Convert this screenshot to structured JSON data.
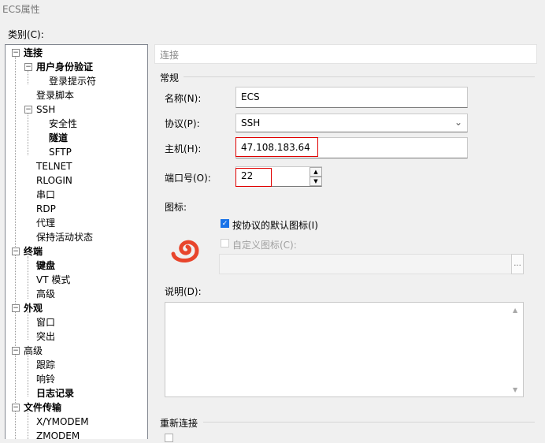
{
  "window": {
    "title": "ECS属性"
  },
  "category": {
    "label": "类别(C):"
  },
  "tree": [
    {
      "label": "连接"
    },
    {
      "label": "用户身份验证"
    },
    {
      "label": "登录提示符"
    },
    {
      "label": "登录脚本"
    },
    {
      "label": "SSH"
    },
    {
      "label": "安全性"
    },
    {
      "label": "隧道"
    },
    {
      "label": "SFTP"
    },
    {
      "label": "TELNET"
    },
    {
      "label": "RLOGIN"
    },
    {
      "label": "串口"
    },
    {
      "label": "RDP"
    },
    {
      "label": "代理"
    },
    {
      "label": "保持活动状态"
    },
    {
      "label": "终端"
    },
    {
      "label": "键盘"
    },
    {
      "label": "VT 模式"
    },
    {
      "label": "高级"
    },
    {
      "label": "外观"
    },
    {
      "label": "窗口"
    },
    {
      "label": "突出"
    },
    {
      "label": "高级"
    },
    {
      "label": "跟踪"
    },
    {
      "label": "响铃"
    },
    {
      "label": "日志记录"
    },
    {
      "label": "文件传输"
    },
    {
      "label": "X/YMODEM"
    },
    {
      "label": "ZMODEM"
    }
  ],
  "panel": {
    "header": "连接",
    "general": {
      "label": "常规",
      "name_label": "名称(N):",
      "name_value": "ECS",
      "protocol_label": "协议(P):",
      "protocol_value": "SSH",
      "host_label": "主机(H):",
      "host_value": "47.108.183.64",
      "port_label": "端口号(O):",
      "port_value": "22"
    },
    "icon": {
      "label": "图标:",
      "default_icon": "按协议的默认图标(I)",
      "custom_icon": "自定义图标(C):",
      "browse": "...",
      "icon_name": "xshell-swirl-icon",
      "icon_color": "#e8452c"
    },
    "description": {
      "label": "说明(D):"
    },
    "reconnect": {
      "label": "重新连接"
    }
  },
  "colors": {
    "accent": "#1a73e8",
    "highlight_box": "#e00000"
  }
}
